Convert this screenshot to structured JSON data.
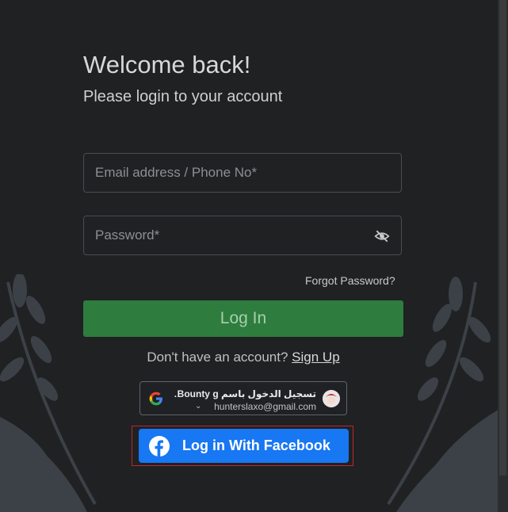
{
  "header": {
    "title": "Welcome back!",
    "subtitle": "Please login to your account"
  },
  "form": {
    "email_placeholder": "Email address / Phone No*",
    "password_placeholder": "Password*",
    "forgot_label": "Forgot Password?",
    "login_label": "Log In"
  },
  "signup": {
    "prompt": "Don't have an account?",
    "link_label": "Sign Up"
  },
  "google": {
    "name_label": "تسجيل الدخول باسم Bounty g…",
    "email": "hunterslaxo@gmail.com"
  },
  "facebook": {
    "label": "Log in With Facebook"
  },
  "colors": {
    "background": "#1f2123",
    "login_green": "#2e7d3e",
    "facebook_blue": "#1877f2",
    "highlight_red": "#c0262b"
  }
}
